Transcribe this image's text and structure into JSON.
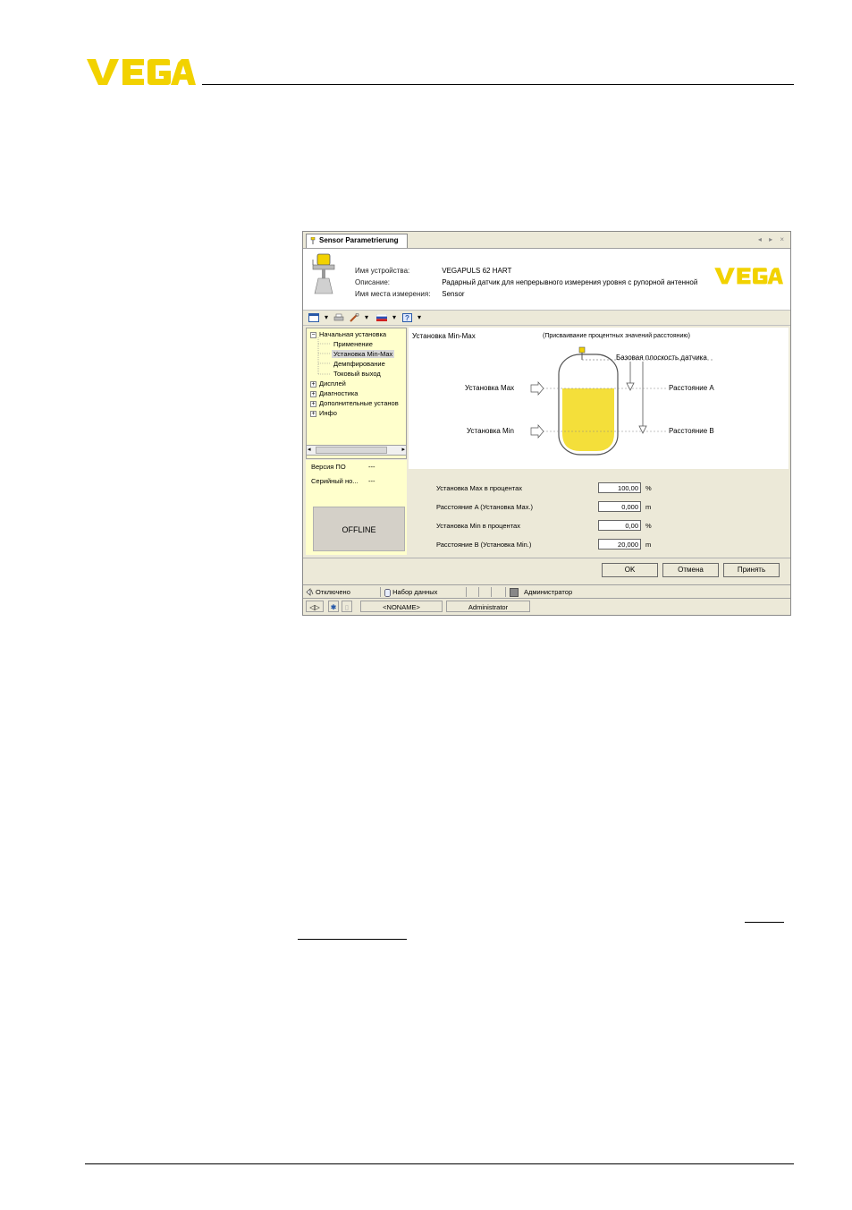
{
  "brand": {
    "logo_text": "VEGA",
    "accent": "#f2d200"
  },
  "window": {
    "tab_title": "Sensor Parametrierung",
    "tab_controls": "◂ ▸ ×",
    "device": {
      "name_label": "Имя устройства:",
      "name_value": "VEGAPULS 62 HART",
      "desc_label": "Описание:",
      "desc_value": "Радарный датчик для непрерывного измерения уровня с рупорной антенной",
      "place_label": "Имя места измерения:",
      "place_value": "Sensor"
    },
    "tree": {
      "items": [
        {
          "label": "Начальная установка",
          "expander": "−"
        },
        {
          "label": "Применение"
        },
        {
          "label": "Установка Min-Max"
        },
        {
          "label": "Демпфирование"
        },
        {
          "label": "Токовый выход"
        },
        {
          "label": "Дисплей",
          "expander": "+"
        },
        {
          "label": "Диагностика",
          "expander": "+"
        },
        {
          "label": "Дополнительные установ",
          "expander": "+"
        },
        {
          "label": "Инфо",
          "expander": "+"
        }
      ]
    },
    "info": {
      "fw_label": "Версия ПО",
      "fw_value": "---",
      "serial_label": "Серийный но...",
      "serial_value": "---",
      "offline": "OFFLINE"
    },
    "panel": {
      "title": "Установка Min-Max",
      "subtitle": "(Присваивание процентных значений расстоянию)",
      "reference_plane": "Базовая плоскость датчика",
      "adj_max": "Установка Max",
      "adj_min": "Установка Min",
      "distance_a": "Расстояние A",
      "distance_b": "Расстояние B"
    },
    "fields": [
      {
        "label": "Установка Max в процентах",
        "value": "100,00",
        "unit": "%"
      },
      {
        "label": "Расстояние A (Установка Max.)",
        "value": "0,000",
        "unit": "m"
      },
      {
        "label": "Установка Min в процентах",
        "value": "0,00",
        "unit": "%"
      },
      {
        "label": "Расстояние B (Установка Min.)",
        "value": "20,000",
        "unit": "m"
      }
    ],
    "buttons": {
      "ok": "OK",
      "cancel": "Отмена",
      "apply": "Принять"
    },
    "status": {
      "disconnected": "Отключено",
      "dataset": "Набор данных",
      "role": "Администратор"
    },
    "status2": {
      "project": "<NONAME>",
      "user": "Administrator"
    }
  }
}
